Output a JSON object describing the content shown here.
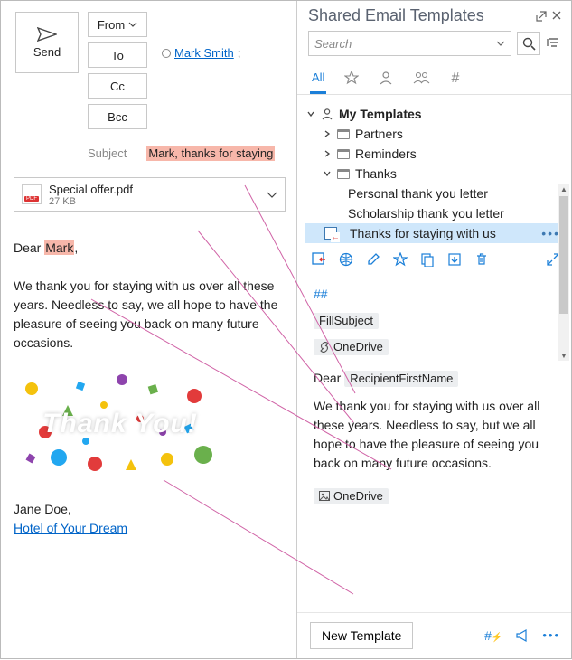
{
  "compose": {
    "send_label": "Send",
    "from_label": "From",
    "to_label": "To",
    "cc_label": "Cc",
    "bcc_label": "Bcc",
    "recipient_name": "Mark Smith",
    "subject_label": "Subject",
    "subject_value": "Mark, thanks for staying",
    "attachment": {
      "name": "Special offer.pdf",
      "size": "27 KB"
    },
    "body_greeting_prefix": "Dear ",
    "body_greeting_name": "Mark",
    "body_greeting_suffix": ",",
    "body_text": "We thank you for staying with us over all these years. Needless to say, we all hope to have the pleasure of seeing you back on many future occasions.",
    "thank_you_image_text": "Thank You!",
    "signature_name": "Jane Doe,",
    "signature_link": "Hotel of Your Dream"
  },
  "templates": {
    "panel_title": "Shared Email Templates",
    "search_placeholder": "Search",
    "tabs": {
      "all_label": "All"
    },
    "tree": {
      "root_label": "My Templates",
      "folders": {
        "partners": "Partners",
        "reminders": "Reminders",
        "thanks": "Thanks"
      },
      "thanks_items": {
        "personal": "Personal thank you letter",
        "scholarship": "Scholarship thank you letter",
        "staying": "Thanks for staying with us"
      }
    },
    "preview": {
      "hashes": "##",
      "fill_subject": "FillSubject",
      "onedrive_attach": "OneDrive",
      "greeting_prefix": "Dear ",
      "recipient_macro": "RecipientFirstName",
      "body_text": "We thank you for staying with us over all these years. Needless  to say, but we all hope to have the pleasure of seeing you back on many future occasions.",
      "onedrive_image": "OneDrive"
    },
    "new_template_label": "New Template"
  }
}
